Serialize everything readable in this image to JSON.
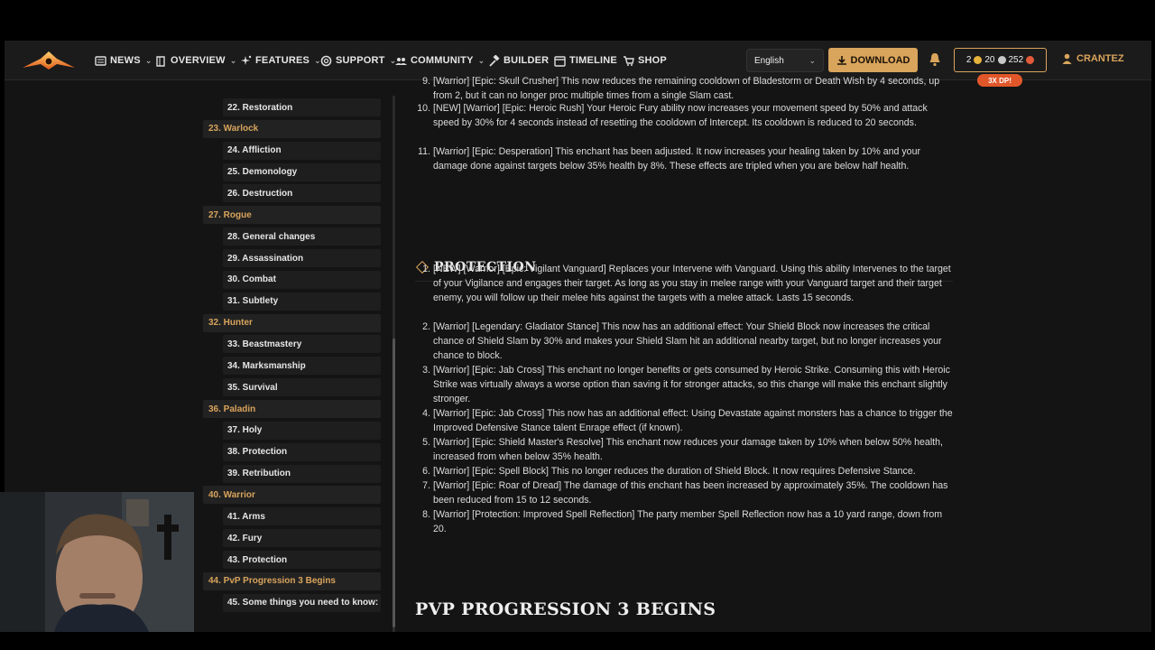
{
  "nav": {
    "items": [
      {
        "label": "NEWS",
        "icon": "newspaper-icon",
        "has_dropdown": true
      },
      {
        "label": "OVERVIEW",
        "icon": "book-icon",
        "has_dropdown": true
      },
      {
        "label": "FEATURES",
        "icon": "sparkle-icon",
        "has_dropdown": true
      },
      {
        "label": "SUPPORT",
        "icon": "lifebuoy-icon",
        "has_dropdown": true
      },
      {
        "label": "COMMUNITY",
        "icon": "users-icon",
        "has_dropdown": true
      },
      {
        "label": "BUILDER",
        "icon": "hammer-icon",
        "has_dropdown": false
      },
      {
        "label": "TIMELINE",
        "icon": "calendar-icon",
        "has_dropdown": false
      },
      {
        "label": "SHOP",
        "icon": "cart-icon",
        "has_dropdown": false
      }
    ],
    "language": "English",
    "download_label": "DOWNLOAD",
    "currency": {
      "gold": "2",
      "silver": "20",
      "dp": "252"
    },
    "dp_badge": "3X DP!",
    "username": "CRANTEZ",
    "accent": "#d9a45c"
  },
  "toc": [
    {
      "label": "22. Restoration",
      "level": "sub"
    },
    {
      "label": "23. Warlock",
      "level": "main"
    },
    {
      "label": "24. Affliction",
      "level": "sub"
    },
    {
      "label": "25. Demonology",
      "level": "sub"
    },
    {
      "label": "26. Destruction",
      "level": "sub"
    },
    {
      "label": "27. Rogue",
      "level": "main"
    },
    {
      "label": "28. General changes",
      "level": "sub"
    },
    {
      "label": "29. Assassination",
      "level": "sub"
    },
    {
      "label": "30. Combat",
      "level": "sub"
    },
    {
      "label": "31. Subtlety",
      "level": "sub"
    },
    {
      "label": "32. Hunter",
      "level": "main"
    },
    {
      "label": "33. Beastmastery",
      "level": "sub"
    },
    {
      "label": "34. Marksmanship",
      "level": "sub"
    },
    {
      "label": "35. Survival",
      "level": "sub"
    },
    {
      "label": "36. Paladin",
      "level": "main"
    },
    {
      "label": "37. Holy",
      "level": "sub"
    },
    {
      "label": "38. Protection",
      "level": "sub"
    },
    {
      "label": "39. Retribution",
      "level": "sub"
    },
    {
      "label": "40. Warrior",
      "level": "main"
    },
    {
      "label": "41. Arms",
      "level": "sub"
    },
    {
      "label": "42. Fury",
      "level": "sub"
    },
    {
      "label": "43. Protection",
      "level": "sub"
    },
    {
      "label": "44. PvP Progression 3 Begins",
      "level": "main"
    },
    {
      "label": "45. Some things you need to know:",
      "level": "sub"
    }
  ],
  "fury_list": [
    {
      "num": "9.",
      "text": "[Warrior] [Epic: Skull Crusher] This now reduces the remaining cooldown of Bladestorm or Death Wish by 4 seconds, up from 2, but it can no longer proc multiple times from a single Slam cast."
    },
    {
      "num": "10.",
      "text": "[NEW] [Warrior] [Epic: Heroic Rush] Your Heroic Fury ability now increases your movement speed by 50% and attack speed by 30% for 4 seconds instead of resetting the cooldown of Intercept. Its cooldown is reduced to 20 seconds."
    },
    {
      "num": "11.",
      "text": "[Warrior] [Epic: Desperation] This enchant has been adjusted. It now increases your healing taken by 10% and your damage done against targets below 35% health by 8%. These effects are tripled when you are below half health."
    }
  ],
  "protection": {
    "heading": "PROTECTION",
    "items": [
      {
        "num": "1.",
        "text": "[NEW] [Warrior] [Epic: Vigilant Vanguard] Replaces your Intervene with Vanguard. Using this ability Intervenes to the target of your Vigilance and engages their target. As long as you stay in melee range with your Vanguard target and their target enemy, you will follow up their melee hits against the targets with a melee attack. Lasts 15 seconds."
      },
      {
        "num": "2.",
        "text": "[Warrior] [Legendary: Gladiator Stance] This now has an additional effect: Your Shield Block now increases the critical chance of Shield Slam by 30% and makes your Shield Slam hit an additional nearby target, but no longer increases your chance to block."
      },
      {
        "num": "3.",
        "text": "[Warrior] [Epic: Jab Cross] This enchant no longer benefits or gets consumed by Heroic Strike. Consuming this with Heroic Strike was virtually always a worse option than saving it for stronger attacks, so this change will make this enchant slightly stronger."
      },
      {
        "num": "4.",
        "text": "[Warrior] [Epic: Jab Cross] This now has an additional effect: Using Devastate against monsters has a chance to trigger the Improved Defensive Stance talent Enrage effect (if known)."
      },
      {
        "num": "5.",
        "text": "[Warrior] [Epic: Shield Master's Resolve] This enchant now reduces your damage taken by 10% when below 50% health, increased from when below 35% health."
      },
      {
        "num": "6.",
        "text": "[Warrior] [Epic: Spell Block] This no longer reduces the duration of Shield Block. It now requires Defensive Stance."
      },
      {
        "num": "7.",
        "text": "[Warrior] [Epic: Roar of Dread] The damage of this enchant has been increased by approximately 35%. The cooldown has been reduced from 15 to 12 seconds."
      },
      {
        "num": "8.",
        "text": "[Warrior] [Protection: Improved Spell Reflection] The party member Spell Reflection now has a 10 yard range, down from 20."
      }
    ]
  },
  "pvp_heading": "PVP PROGRESSION 3 BEGINS"
}
